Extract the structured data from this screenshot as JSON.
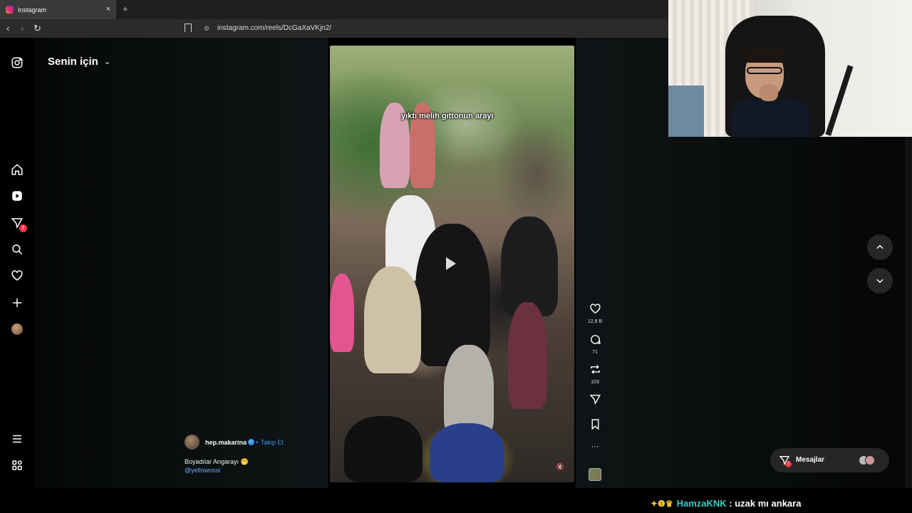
{
  "browser": {
    "tab_title": "Instagram",
    "tab_close": "×",
    "new_tab": "+",
    "url": "instagram.com/reels/DcGaXaVKjn2/",
    "back": "‹",
    "forward": "›",
    "reload": "↻"
  },
  "header": {
    "feed_title": "Senin için",
    "feed_chevron": "⌄"
  },
  "sidebar": {
    "items": [
      {
        "name": "instagram-logo-icon"
      },
      {
        "name": "home-icon"
      },
      {
        "name": "reels-icon"
      },
      {
        "name": "messages-icon",
        "badge": "2"
      },
      {
        "name": "search-icon"
      },
      {
        "name": "notifications-icon"
      },
      {
        "name": "create-icon"
      },
      {
        "name": "profile-avatar"
      },
      {
        "name": "menu-icon"
      },
      {
        "name": "also-from-meta-icon"
      }
    ]
  },
  "reel": {
    "caption_overlay": "yıktı melih gıttonun arayı",
    "author": "hep.makarina",
    "separator": "•",
    "follow_label": "Takip Et",
    "verified_mark": "✓",
    "description": "Boyadılar Angarayı 🤭",
    "tag": "@yellowossi",
    "mute_icon": "🔇"
  },
  "actions": {
    "likes": "12,8 B",
    "comments": "71",
    "reposts": "103",
    "more": "···"
  },
  "messages": {
    "label": "Mesajlar",
    "badge": "2"
  },
  "stream_chat": {
    "badges": "✦❶♛",
    "user": "HamzaKNK",
    "message": ": uzak mı ankara"
  },
  "colors": {
    "accent_blue": "#3797f0",
    "badge_red": "#ff3040",
    "chat_user": "#33d1c8"
  }
}
